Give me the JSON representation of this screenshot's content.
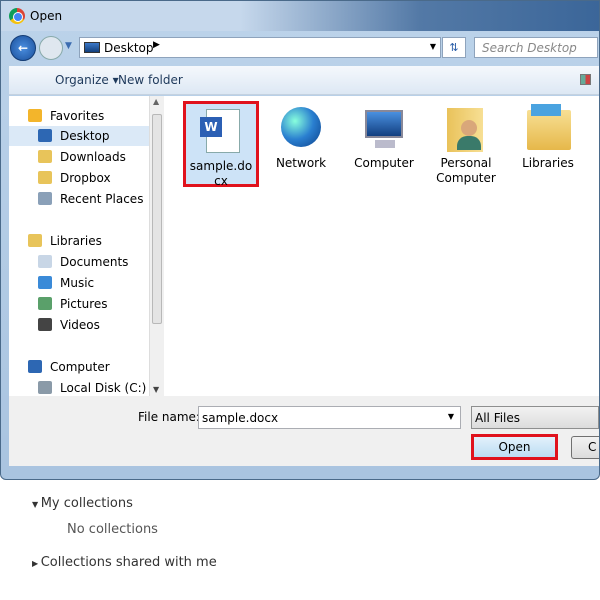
{
  "window": {
    "title": "Open"
  },
  "nav": {
    "back": "back",
    "address": "Desktop",
    "search_placeholder": "Search Desktop"
  },
  "toolbar": {
    "organize": "Organize ▾",
    "new_folder": "New folder"
  },
  "sidebar": {
    "items": [
      {
        "label": "Favorites",
        "icon": "star-icon",
        "color": "#f3b52b"
      },
      {
        "label": "Desktop",
        "icon": "desktop-icon",
        "color": "#2d67b3",
        "selected": true
      },
      {
        "label": "Downloads",
        "icon": "downloads-folder-icon",
        "color": "#e8c45a"
      },
      {
        "label": "Dropbox",
        "icon": "dropbox-folder-icon",
        "color": "#e8c45a"
      },
      {
        "label": "Recent Places",
        "icon": "recent-places-icon",
        "color": "#8aa0b8"
      },
      {
        "label": "Libraries",
        "icon": "libraries-icon",
        "color": "#e8c45a"
      },
      {
        "label": "Documents",
        "icon": "documents-icon",
        "color": "#c8d6e6"
      },
      {
        "label": "Music",
        "icon": "music-icon",
        "color": "#3a8ad8"
      },
      {
        "label": "Pictures",
        "icon": "pictures-icon",
        "color": "#5aa06a"
      },
      {
        "label": "Videos",
        "icon": "videos-icon",
        "color": "#444444"
      },
      {
        "label": "Computer",
        "icon": "computer-icon",
        "color": "#2d67b3"
      },
      {
        "label": "Local Disk (C:)",
        "icon": "local-disk-icon",
        "color": "#8a9aa8"
      }
    ]
  },
  "files": [
    {
      "label": "sample.docx",
      "icon": "word-document-icon",
      "selected": true
    },
    {
      "label": "Network",
      "icon": "network-icon"
    },
    {
      "label": "Computer",
      "icon": "computer-icon"
    },
    {
      "label": "Personal Computer",
      "icon": "user-folder-icon"
    },
    {
      "label": "Libraries",
      "icon": "libraries-icon"
    }
  ],
  "footer": {
    "file_name_label": "File name:",
    "file_name_value": "sample.docx",
    "file_type": "All Files",
    "open": "Open",
    "cancel": "C"
  },
  "page": {
    "my_collections": "My collections",
    "no_collections": "No collections",
    "shared": "Collections shared with me"
  },
  "colors": {
    "highlight": "#e0121d",
    "selection": "#cde3f7"
  }
}
